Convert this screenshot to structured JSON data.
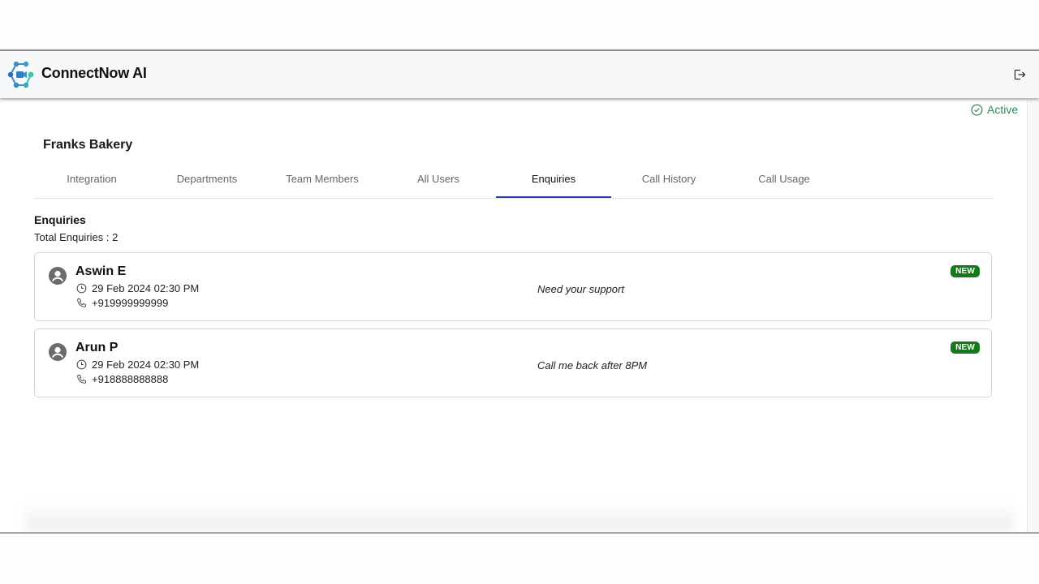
{
  "app": {
    "title": "ConnectNow AI",
    "logo_icon": "connect-network-video-icon",
    "logout_icon": "logout-icon"
  },
  "status": {
    "label": "Active",
    "icon": "check-circle-icon",
    "color": "#2e8b57"
  },
  "organization": {
    "name": "Franks Bakery"
  },
  "tabs": [
    {
      "label": "Integration",
      "active": false
    },
    {
      "label": "Departments",
      "active": false
    },
    {
      "label": "Team Members",
      "active": false
    },
    {
      "label": "All Users",
      "active": false
    },
    {
      "label": "Enquiries",
      "active": true
    },
    {
      "label": "Call History",
      "active": false
    },
    {
      "label": "Call Usage",
      "active": false
    }
  ],
  "enquiries": {
    "title": "Enquiries",
    "total_label": "Total Enquiries : 2",
    "items": [
      {
        "name": "Aswin E",
        "datetime": "29 Feb 2024 02:30 PM",
        "phone": "+919999999999",
        "message": "Need your support",
        "badge": "NEW"
      },
      {
        "name": "Arun P",
        "datetime": "29 Feb 2024 02:30 PM",
        "phone": "+918888888888",
        "message": "Call me back after 8PM",
        "badge": "NEW"
      }
    ]
  },
  "colors": {
    "accent_tab": "#2f3ea8",
    "badge_bg": "#157a1a"
  }
}
